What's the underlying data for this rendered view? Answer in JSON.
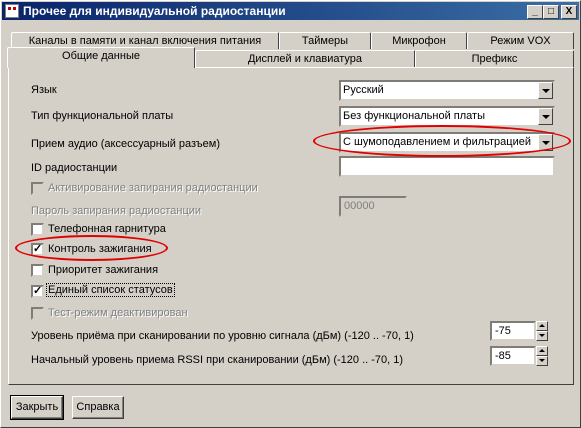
{
  "window": {
    "title": "Прочее для индивидуальной радиостанции",
    "buttons": {
      "minimize": "_",
      "maximize": "□",
      "close": "X"
    }
  },
  "tabs_row1": [
    {
      "label": "Каналы в памяти и канал включения питания"
    },
    {
      "label": "Таймеры"
    },
    {
      "label": "Микрофон"
    },
    {
      "label": "Режим VOX"
    }
  ],
  "tabs_row2": [
    {
      "label": "Общие данные",
      "active": true
    },
    {
      "label": "Дисплей и клавиатура"
    },
    {
      "label": "Префикс"
    }
  ],
  "fields": {
    "language": {
      "label": "Язык",
      "value": "Русский"
    },
    "board_type": {
      "label": "Тип функциональной платы",
      "value": "Без функциональной платы"
    },
    "audio_rx": {
      "label": "Прием аудио (аксессуарный разъем)",
      "value": "С шумоподавлением и фильтрацией"
    },
    "radio_id": {
      "label": "ID радиостанции",
      "value": ""
    },
    "lock_enable": {
      "label": "Активирование запирания радиостанции",
      "checked": false,
      "disabled": true
    },
    "lock_password": {
      "label": "Пароль запирания радиостанции",
      "value": "00000",
      "disabled": true
    },
    "phone_headset": {
      "label": "Телефонная гарнитура",
      "checked": false
    },
    "ignition_control": {
      "label": "Контроль зажигания",
      "checked": true
    },
    "ignition_priority": {
      "label": "Приоритет зажигания",
      "checked": false
    },
    "single_status_list": {
      "label": "Единый список статусов",
      "checked": true
    },
    "test_mode_off": {
      "label": "Тест-режим деактивирован",
      "checked": false,
      "disabled": true
    },
    "scan_level": {
      "label": "Уровень приёма при сканировании по уровню сигнала (дБм) (-120 .. -70, 1)",
      "value": "-75"
    },
    "rssi_level": {
      "label": "Начальный уровень приема RSSI при сканировании (дБм) (-120 .. -70, 1)",
      "value": "-85"
    }
  },
  "footer": {
    "close_label": "Закрыть",
    "help_label": "Справка"
  },
  "colors": {
    "highlight_ellipse": "#e00000",
    "titlebar_start": "#0a246a",
    "titlebar_end": "#3a6ea5"
  }
}
